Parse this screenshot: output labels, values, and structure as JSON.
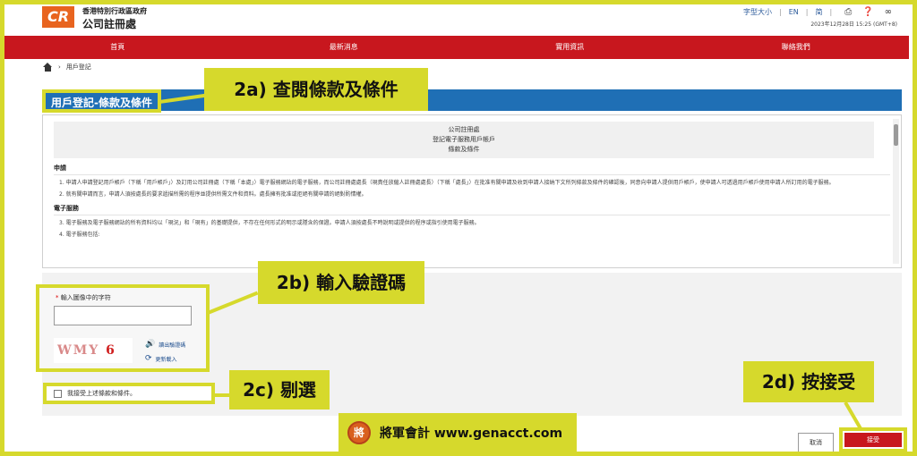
{
  "header": {
    "logo": "CR",
    "gov_name": "香港特別行政區政府",
    "registry_name": "公司註冊處",
    "font_size_label": "字型大小",
    "lang_en": "EN",
    "lang_sc": "简",
    "datetime": "2023年12月28日 15:25 (GMT+8)",
    "icons": [
      "printer-icon",
      "help-icon",
      "share-icon"
    ]
  },
  "nav": [
    "首頁",
    "最新消息",
    "實用資訊",
    "聯絡我們"
  ],
  "breadcrumb": {
    "current": "用戶登記"
  },
  "page_title": "用戶登記-條款及條件",
  "terms": {
    "heading_lines": [
      "公司註冊處",
      "登記電子服務用戶帳戶",
      "條款及條件"
    ],
    "sections": [
      {
        "title": "申請",
        "items": [
          "1. 申請人申請登記用戶帳戶（下稱「用戶帳戶」）及訂用公司註冊處（下稱「本處」）電子服務網站的電子服務，而公司註冊處處長（現責任放僱人註冊處處長）（下稱「處長」）在批准有關申請及收到申請人接納下文所列條款及條件的確認後，同意向申請人提供用戶帳戶，使申請人可透過用戶帳戶使用申請人所訂用的電子服務。",
          "2. 就有關申請而言，申請人須按處長的要求遞描所需的程序並提供所需文件和資料。處長擁有批准或拒絕有關申請的絕對酌情權。"
        ]
      },
      {
        "title": "電子服務",
        "items": [
          "3. 電子服務及電子服務網站的所有資料均以「現況」和「現有」的基礎提供，不存在任何形式的明示或隱含的保證。申請人須按處長不時說明或提供的程序或指引使用電子服務。",
          "4. 電子服務包括:"
        ]
      }
    ]
  },
  "captcha": {
    "label": "輸入圖像中的字符",
    "required_mark": "*",
    "input_value": "",
    "image_text_a": "WMY",
    "image_text_b": "6",
    "audio_label": "讀出驗證碼",
    "refresh_label": "更新載入"
  },
  "agree": {
    "label": "我接受上述條款和條件。",
    "checked": false
  },
  "buttons": {
    "cancel": "取消",
    "accept": "接受"
  },
  "callouts": {
    "step_a": "2a) 查閱條款及條件",
    "step_b": "2b) 輸入驗證碼",
    "step_c": "2c) 剔選",
    "step_d": "2d) 按接受"
  },
  "brand": {
    "seal": "將",
    "text": "將軍會計 www.genacct.com"
  },
  "colors": {
    "accent_yellow": "#d6d92c",
    "nav_red": "#c8171e",
    "title_blue": "#1f6fb5",
    "logo_orange": "#e8641f"
  }
}
